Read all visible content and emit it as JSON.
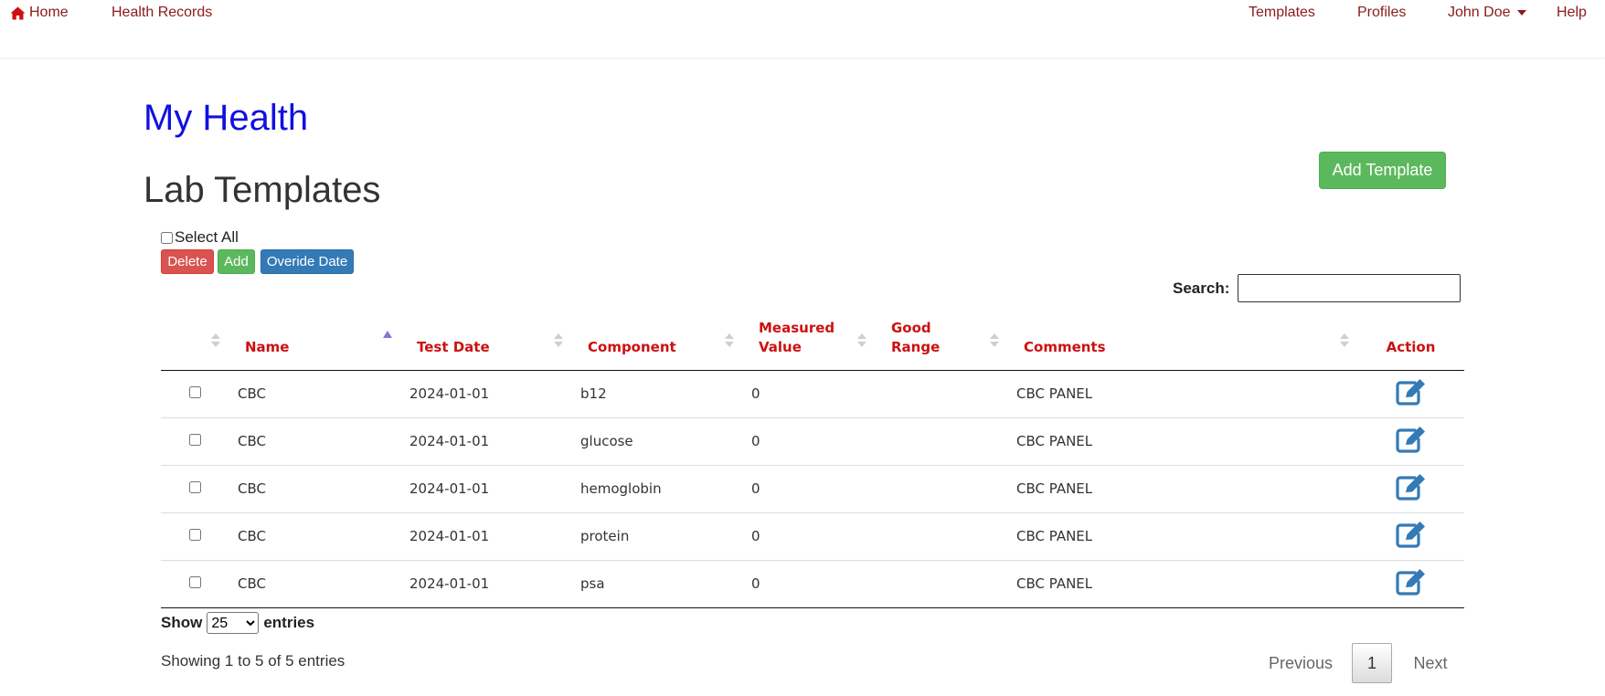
{
  "nav": {
    "home": "Home",
    "health_records": "Health Records",
    "templates": "Templates",
    "profiles": "Profiles",
    "user": "John Doe",
    "help": "Help"
  },
  "app_title": "My Health",
  "page_title": "Lab Templates",
  "add_template_button": "Add Template",
  "select_all_label": "Select All",
  "bulk_actions": {
    "delete": "Delete",
    "add": "Add",
    "override_date": "Overide Date"
  },
  "search": {
    "label": "Search:",
    "value": ""
  },
  "table": {
    "columns": [
      "Name",
      "Test Date",
      "Component",
      "Measured Value",
      "Good Range",
      "Comments",
      "Action"
    ],
    "sorted_column": "Name",
    "rows": [
      {
        "name": "CBC",
        "test_date": "2024-01-01",
        "component": "b12",
        "measured_value": "0",
        "good_range": "",
        "comments": "CBC PANEL"
      },
      {
        "name": "CBC",
        "test_date": "2024-01-01",
        "component": "glucose",
        "measured_value": "0",
        "good_range": "",
        "comments": "CBC PANEL"
      },
      {
        "name": "CBC",
        "test_date": "2024-01-01",
        "component": "hemoglobin",
        "measured_value": "0",
        "good_range": "",
        "comments": "CBC PANEL"
      },
      {
        "name": "CBC",
        "test_date": "2024-01-01",
        "component": "protein",
        "measured_value": "0",
        "good_range": "",
        "comments": "CBC PANEL"
      },
      {
        "name": "CBC",
        "test_date": "2024-01-01",
        "component": "psa",
        "measured_value": "0",
        "good_range": "",
        "comments": "CBC PANEL"
      }
    ]
  },
  "length_menu": {
    "prefix": "Show",
    "selected": "25",
    "suffix": "entries"
  },
  "info_text": "Showing 1 to 5 of 5 entries",
  "pagination": {
    "previous": "Previous",
    "current": "1",
    "next": "Next"
  },
  "colors": {
    "nav_link": "#8b1a1a",
    "app_title": "#1010e0",
    "header_text": "#cc1111",
    "edit_icon": "#337ab7"
  },
  "icons": {
    "home": "home-icon",
    "edit": "edit-icon"
  }
}
